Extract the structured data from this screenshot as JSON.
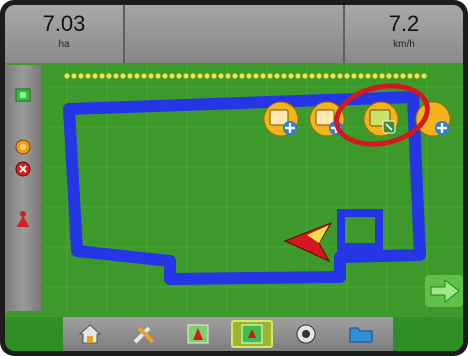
{
  "top_bar": {
    "area_value": "7.03",
    "area_unit": "ha",
    "speed_value": "7.2",
    "speed_unit": "km/h"
  },
  "left_bar": {
    "icons": [
      "boom-status-icon",
      "steering-icon",
      "alert-icon",
      "marker-icon"
    ]
  },
  "map": {
    "tools": [
      {
        "name": "new-boundary-icon"
      },
      {
        "name": "edit-boundary-icon"
      },
      {
        "name": "delete-boundary-icon"
      },
      {
        "name": "add-boundary-icon"
      }
    ],
    "highlighted_tool": "delete-boundary-icon"
  },
  "bottom_tabs": [
    {
      "name": "tab-home",
      "icon": "home-icon"
    },
    {
      "name": "tab-setup",
      "icon": "tools-icon"
    },
    {
      "name": "tab-guidance",
      "icon": "guidance-icon"
    },
    {
      "name": "tab-map",
      "icon": "map-icon",
      "active": true
    },
    {
      "name": "tab-camera",
      "icon": "camera-icon"
    },
    {
      "name": "tab-data",
      "icon": "folder-icon"
    }
  ],
  "colors": {
    "field": "#3d9a2a",
    "coverage": "#2436e6",
    "highlight": "#d4181f",
    "tool_button": "#f2b41a"
  }
}
